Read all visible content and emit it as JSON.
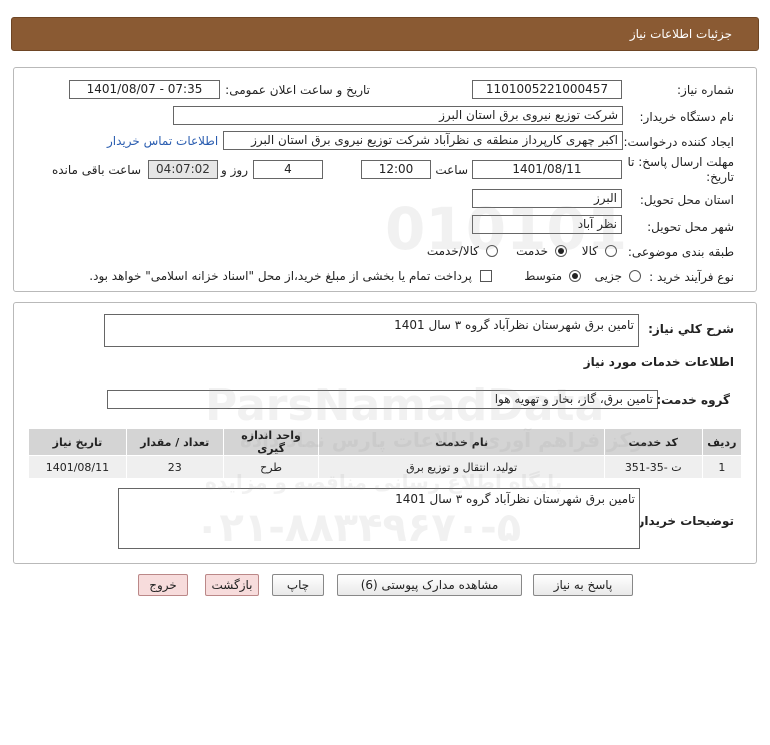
{
  "header": {
    "title": "جزئیات اطلاعات نیاز"
  },
  "need_number": {
    "label": "شماره نیاز:",
    "value": "1101005221000457"
  },
  "announce_datetime": {
    "label": "تاریخ و ساعت اعلان عمومی:",
    "value": "1401/08/07 - 07:35"
  },
  "buyer_org": {
    "label": "نام دستگاه خریدار:",
    "value": "شرکت توزیع نیروی برق استان البرز"
  },
  "requester": {
    "label": "ایجاد کننده درخواست:",
    "value": "اکبر چهری کارپرداز منطقه ی نظرآباد شرکت توزیع نیروی برق استان البرز",
    "contact_link": "اطلاعات تماس خریدار"
  },
  "deadline": {
    "label_line1": "مهلت ارسال پاسخ: تا",
    "label_line2": "تاریخ:",
    "date": "1401/08/11",
    "time_label": "ساعت",
    "time": "12:00",
    "days": "4",
    "days_label": "روز و",
    "remaining": "04:07:02",
    "remaining_label": "ساعت باقی مانده"
  },
  "delivery_province": {
    "label": "استان محل تحویل:",
    "value": "البرز"
  },
  "delivery_city": {
    "label": "شهر محل تحویل:",
    "value": "نظر آباد"
  },
  "category": {
    "label": "طبقه بندی موضوعی:",
    "options": [
      "کالا",
      "خدمت",
      "کالا/خدمت"
    ],
    "selected": "خدمت"
  },
  "purchase_type": {
    "label": "نوع فرآیند خرید :",
    "options": [
      "جزیی",
      "متوسط"
    ],
    "selected": "متوسط",
    "checkbox_text": "پرداخت تمام یا بخشی از مبلغ خرید،از محل \"اسناد خزانه اسلامی\" خواهد بود."
  },
  "general_desc": {
    "label": "شرح کلي نياز:",
    "value": "تامین برق شهرستان نظرآباد گروه ۳ سال 1401"
  },
  "services_title": "اطلاعات خدمات مورد نیاز",
  "service_group": {
    "label": "گروه خدمت:",
    "value": "تامین برق، گاز، بخار و تهویه هوا"
  },
  "table": {
    "headers": [
      "ردیف",
      "کد خدمت",
      "نام خدمت",
      "واحد اندازه گیری",
      "تعداد / مقدار",
      "تاریخ نیاز"
    ],
    "rows": [
      [
        "1",
        "ت -35-351",
        "تولید، انتقال و توزیع برق",
        "طرح",
        "23",
        "1401/08/11"
      ]
    ]
  },
  "buyer_notes": {
    "label": "توضیحات خریدار:",
    "value": "تامین برق شهرستان نظرآباد گروه ۳ سال 1401"
  },
  "buttons": {
    "reply": "پاسخ به نیاز",
    "attachments": "مشاهده مدارک پیوستی (6)",
    "print": "چاپ",
    "back": "بازگشت",
    "exit": "خروج"
  },
  "watermark": {
    "line1": "010101",
    "line2": "ParsNamadData",
    "line3": "مرکز فراهم آوری اطلاعات پارس نماد داده",
    "line4": "پایگاه اطلاع رسانی مناقصه و مزایده",
    "line5": "۰۲۱-۸۸۳۴۹۶۷۰-۵"
  }
}
